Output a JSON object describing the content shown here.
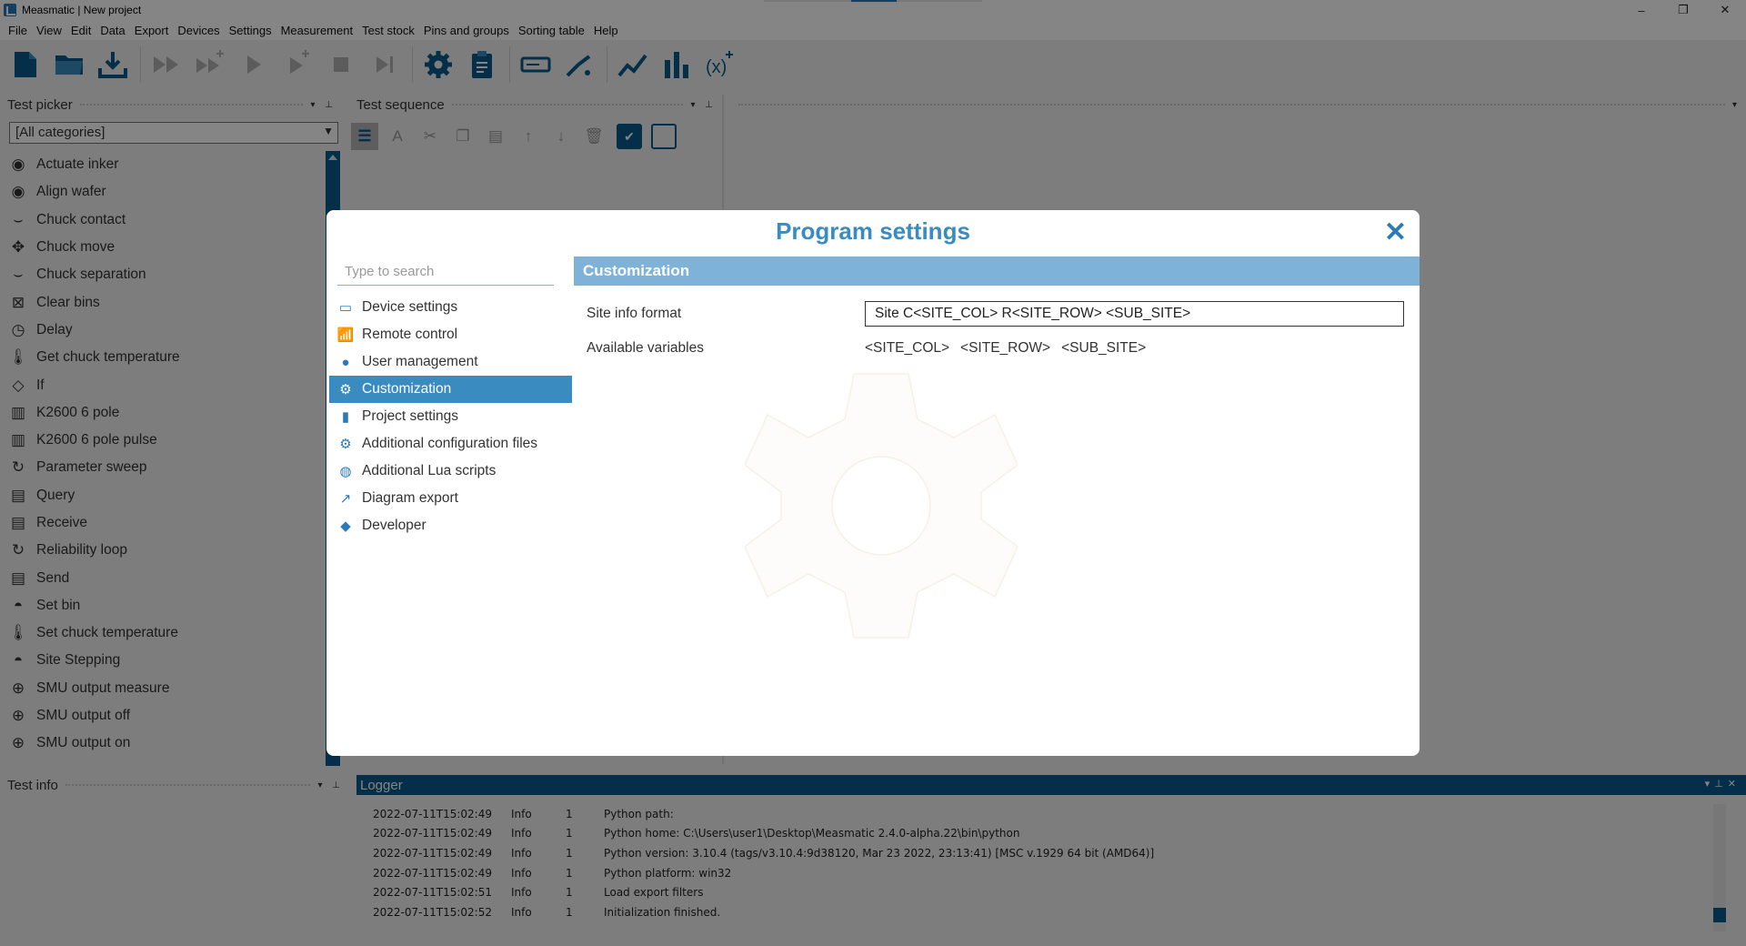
{
  "window": {
    "title": "Measmatic | New project",
    "controls": [
      "–",
      "❐",
      "✕"
    ]
  },
  "menu": [
    "File",
    "View",
    "Edit",
    "Data",
    "Export",
    "Devices",
    "Settings",
    "Measurement",
    "Test stock",
    "Pins and groups",
    "Sorting table",
    "Help"
  ],
  "panels": {
    "test_picker": "Test picker",
    "test_sequence": "Test sequence",
    "test_info": "Test info",
    "logger": "Logger"
  },
  "category_select": "[All categories]",
  "test_picker_items": [
    "Actuate inker",
    "Align wafer",
    "Chuck contact",
    "Chuck move",
    "Chuck separation",
    "Clear bins",
    "Delay",
    "Get chuck temperature",
    "If",
    "K2600 6 pole",
    "K2600 6 pole pulse",
    "Parameter sweep",
    "Query",
    "Receive",
    "Reliability loop",
    "Send",
    "Set bin",
    "Set chuck temperature",
    "Site Stepping",
    "SMU output measure",
    "SMU output off",
    "SMU output on"
  ],
  "logger": {
    "rows": [
      {
        "time": "2022-07-11T15:02:49",
        "level": "Info",
        "num": "1",
        "msg": "Python path:"
      },
      {
        "time": "2022-07-11T15:02:49",
        "level": "Info",
        "num": "1",
        "msg": "Python home: C:\\Users\\user1\\Desktop\\Measmatic 2.4.0-alpha.22\\bin\\python"
      },
      {
        "time": "2022-07-11T15:02:49",
        "level": "Info",
        "num": "1",
        "msg": "Python version: 3.10.4 (tags/v3.10.4:9d38120, Mar 23 2022, 23:13:41) [MSC v.1929 64 bit (AMD64)]"
      },
      {
        "time": "2022-07-11T15:02:49",
        "level": "Info",
        "num": "1",
        "msg": "Python platform: win32"
      },
      {
        "time": "2022-07-11T15:02:51",
        "level": "Info",
        "num": "1",
        "msg": "Load export filters"
      },
      {
        "time": "2022-07-11T15:02:52",
        "level": "Info",
        "num": "1",
        "msg": "Initialization finished."
      }
    ]
  },
  "dialog": {
    "title": "Program settings",
    "close": "✕",
    "search_placeholder": "Type to search",
    "nav": [
      {
        "label": "Device settings",
        "icon": "device-icon"
      },
      {
        "label": "Remote control",
        "icon": "remote-icon"
      },
      {
        "label": "User management",
        "icon": "user-icon"
      },
      {
        "label": "Customization",
        "icon": "gear-icon"
      },
      {
        "label": "Project settings",
        "icon": "document-icon"
      },
      {
        "label": "Additional configuration files",
        "icon": "gears-icon"
      },
      {
        "label": "Additional Lua scripts",
        "icon": "globe-gear-icon"
      },
      {
        "label": "Diagram export",
        "icon": "chart-line-icon"
      },
      {
        "label": "Developer",
        "icon": "android-icon"
      }
    ],
    "active_nav": "Customization",
    "section_title": "Customization",
    "site_info_label": "Site info format",
    "site_info_value": "Site C<SITE_COL> R<SITE_ROW> <SUB_SITE>",
    "available_vars_label": "Available variables",
    "available_vars": [
      "<SITE_COL>",
      "<SITE_ROW>",
      "<SUB_SITE>"
    ]
  },
  "colors": {
    "accent": "#3a8cc0",
    "dark_blue": "#0b5a8c",
    "section_bg": "#7fb2d9"
  }
}
